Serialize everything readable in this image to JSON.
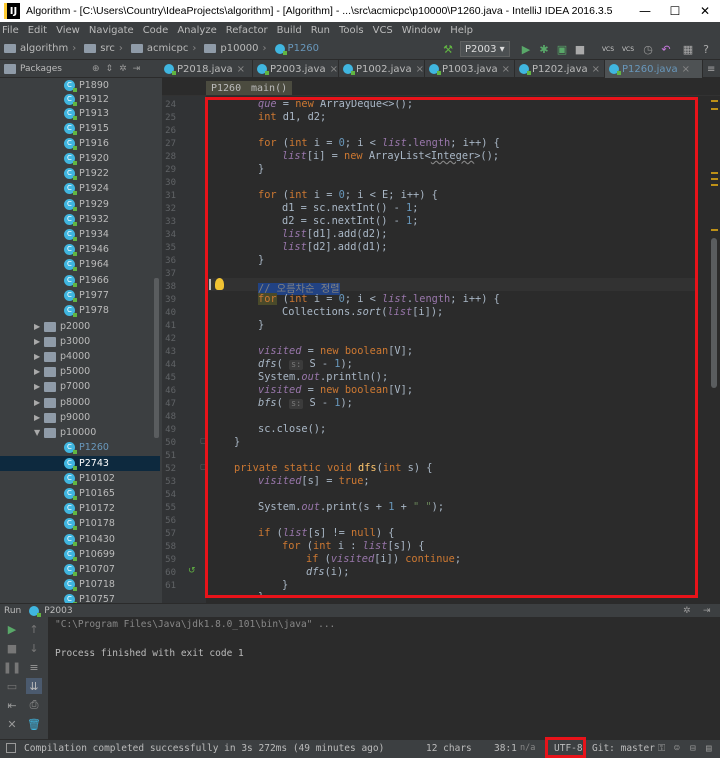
{
  "window": {
    "title": "Algorithm - [C:\\Users\\Country\\IdeaProjects\\algorithm] - [Algorithm] - ...\\src\\acmicpc\\p10000\\P1260.java - IntelliJ IDEA 2016.3.5",
    "minimize": "—",
    "maximize": "☐",
    "close": "✕"
  },
  "menu": [
    "File",
    "Edit",
    "View",
    "Navigate",
    "Code",
    "Analyze",
    "Refactor",
    "Build",
    "Run",
    "Tools",
    "VCS",
    "Window",
    "Help"
  ],
  "breadcrumb": [
    "algorithm",
    "src",
    "acmicpc",
    "p10000",
    "P1260"
  ],
  "run_config": "P2003 ▾",
  "vcs_labels": [
    "VCS",
    "VCS"
  ],
  "project_header": "Packages",
  "tabs": [
    {
      "label": "P2018.java",
      "active": false
    },
    {
      "label": "P2003.java",
      "active": false
    },
    {
      "label": "P1002.java",
      "active": false
    },
    {
      "label": "P1003.java",
      "active": false
    },
    {
      "label": "P1202.java",
      "active": false
    },
    {
      "label": "P1260.java",
      "active": true
    }
  ],
  "tree": [
    {
      "label": "P1890",
      "type": "class"
    },
    {
      "label": "P1912",
      "type": "class"
    },
    {
      "label": "P1913",
      "type": "class"
    },
    {
      "label": "P1915",
      "type": "class"
    },
    {
      "label": "P1916",
      "type": "class"
    },
    {
      "label": "P1920",
      "type": "class"
    },
    {
      "label": "P1922",
      "type": "class"
    },
    {
      "label": "P1924",
      "type": "class"
    },
    {
      "label": "P1929",
      "type": "class"
    },
    {
      "label": "P1932",
      "type": "class"
    },
    {
      "label": "P1934",
      "type": "class"
    },
    {
      "label": "P1946",
      "type": "class"
    },
    {
      "label": "P1964",
      "type": "class"
    },
    {
      "label": "P1966",
      "type": "class"
    },
    {
      "label": "P1977",
      "type": "class"
    },
    {
      "label": "P1978",
      "type": "class"
    },
    {
      "label": "p2000",
      "type": "package"
    },
    {
      "label": "p3000",
      "type": "package"
    },
    {
      "label": "p4000",
      "type": "package"
    },
    {
      "label": "p5000",
      "type": "package"
    },
    {
      "label": "p7000",
      "type": "package"
    },
    {
      "label": "p8000",
      "type": "package"
    },
    {
      "label": "p9000",
      "type": "package"
    },
    {
      "label": "p10000",
      "type": "package-open"
    },
    {
      "label": "P1260",
      "type": "class-current"
    },
    {
      "label": "P2743",
      "type": "class-selected"
    },
    {
      "label": "P10102",
      "type": "class"
    },
    {
      "label": "P10165",
      "type": "class"
    },
    {
      "label": "P10172",
      "type": "class"
    },
    {
      "label": "P10178",
      "type": "class"
    },
    {
      "label": "P10430",
      "type": "class"
    },
    {
      "label": "P10699",
      "type": "class"
    },
    {
      "label": "P10707",
      "type": "class"
    },
    {
      "label": "P10718",
      "type": "class"
    },
    {
      "label": "P10757",
      "type": "class"
    }
  ],
  "editor_breadcrumb": [
    "P1260",
    "main()"
  ],
  "line_numbers": [
    "24",
    "25",
    "26",
    "27",
    "28",
    "29",
    "30",
    "31",
    "32",
    "33",
    "34",
    "35",
    "36",
    "37",
    "38",
    "39",
    "40",
    "41",
    "42",
    "43",
    "44",
    "45",
    "46",
    "47",
    "48",
    "49",
    "50",
    "51",
    "52",
    "53",
    "54",
    "55",
    "56",
    "57",
    "58",
    "59",
    "60",
    "61"
  ],
  "code": {
    "l24_a": "que",
    "l24_b": " = ",
    "l24_c": "new",
    "l24_d": " ArrayDeque<>();",
    "l25_a": "int",
    "l25_b": " d1, d2;",
    "l27_a": "for",
    "l27_b": " (",
    "l27_c": "int",
    "l27_d": " i = ",
    "l27_e": "0",
    "l27_f": "; i < ",
    "l27_g": "list",
    "l27_h": ".",
    "l27_i": "length",
    "l27_j": "; i++) {",
    "l28_a": "list",
    "l28_b": "[i] = ",
    "l28_c": "new",
    "l28_d": " ArrayList<",
    "l28_e": "Integer",
    "l28_f": ">();",
    "l29": "}",
    "l31_a": "for",
    "l31_b": " (",
    "l31_c": "int",
    "l31_d": " i = ",
    "l31_e": "0",
    "l31_f": "; i < E; i++) {",
    "l32_a": "d1 = sc.nextInt() - ",
    "l32_b": "1",
    "l32_c": ";",
    "l33_a": "d2 = sc.nextInt() - ",
    "l33_b": "1",
    "l33_c": ";",
    "l34_a": "list",
    "l34_b": "[d1].add(d2);",
    "l35_a": "list",
    "l35_b": "[d2].add(d1);",
    "l36": "}",
    "l38": "// 오름차순 정렬",
    "l39_a": "for",
    "l39_b": " (",
    "l39_c": "int",
    "l39_d": " i = ",
    "l39_e": "0",
    "l39_f": "; i < ",
    "l39_g": "list",
    "l39_h": ".",
    "l39_i": "length",
    "l39_j": "; i++) {",
    "l40_a": "Collections.",
    "l40_b": "sort",
    "l40_c": "(",
    "l40_d": "list",
    "l40_e": "[i]);",
    "l41": "}",
    "l43_a": "visited",
    "l43_b": " = ",
    "l43_c": "new",
    "l43_d": " ",
    "l43_e": "boolean",
    "l43_f": "[V];",
    "l44_a": "dfs",
    "l44_b": "( ",
    "l44_c": "s:",
    "l44_d": " S - ",
    "l44_e": "1",
    "l44_f": ");",
    "l45_a": "System.",
    "l45_b": "out",
    "l45_c": ".println();",
    "l46_a": "visited",
    "l46_b": " = ",
    "l46_c": "new",
    "l46_d": " ",
    "l46_e": "boolean",
    "l46_f": "[V];",
    "l47_a": "bfs",
    "l47_b": "( ",
    "l47_c": "s:",
    "l47_d": " S - ",
    "l47_e": "1",
    "l47_f": ");",
    "l49": "sc.close();",
    "l50": "}",
    "l52_a": "private static void ",
    "l52_b": "dfs",
    "l52_c": "(",
    "l52_d": "int",
    "l52_e": " s) {",
    "l53_a": "visited",
    "l53_b": "[s] = ",
    "l53_c": "true",
    "l53_d": ";",
    "l55_a": "System.",
    "l55_b": "out",
    "l55_c": ".print(s + ",
    "l55_d": "1",
    "l55_e": " + ",
    "l55_f": "\" \"",
    "l55_g": ");",
    "l57_a": "if",
    "l57_b": " (",
    "l57_c": "list",
    "l57_d": "[s] != ",
    "l57_e": "null",
    "l57_f": ") {",
    "l58_a": "for",
    "l58_b": " (",
    "l58_c": "int",
    "l58_d": " i : ",
    "l58_e": "list",
    "l58_f": "[s]) {",
    "l59_a": "if",
    "l59_b": " (",
    "l59_c": "visited",
    "l59_d": "[i]) ",
    "l59_e": "continue",
    "l59_f": ";",
    "l60_a": "dfs",
    "l60_b": "(i);",
    "l61": "}",
    "l62": "}"
  },
  "run_panel": {
    "title": "Run",
    "config": "P2003",
    "cmd": "\"C:\\Program Files\\Java\\jdk1.8.0_101\\bin\\java\" ...",
    "result": "Process finished with exit code 1"
  },
  "status": {
    "message": "Compilation completed successfully in 3s 272ms (49 minutes ago)",
    "chars": "12 chars",
    "position": "38:1",
    "line_sep": "n/a",
    "encoding": "UTF-8",
    "git": "Git: master"
  }
}
